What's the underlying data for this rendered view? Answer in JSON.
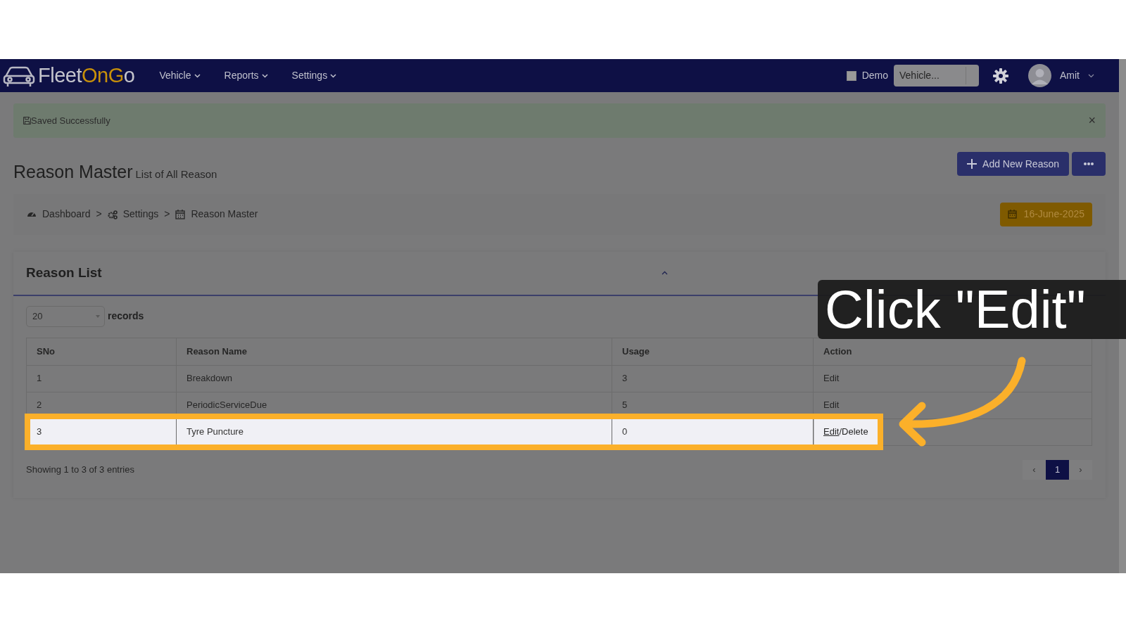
{
  "navbar": {
    "logo": [
      {
        "text": "Fleet",
        "color": "#c4c4cc"
      },
      {
        "text": "On",
        "color": "#c8900a"
      },
      {
        "text": "G",
        "color": "#c8900a"
      },
      {
        "text": "o",
        "color": "#c4c4cc"
      }
    ],
    "menus": [
      {
        "label": "Vehicle"
      },
      {
        "label": "Reports"
      },
      {
        "label": "Settings"
      }
    ],
    "demo": {
      "label": "Demo",
      "checked": false
    },
    "vehicle_select": {
      "value": "Vehicle..."
    },
    "user": {
      "name": "Amit"
    }
  },
  "alert": {
    "text": "Saved Successfully",
    "close": "×"
  },
  "page": {
    "title": "Reason Master",
    "subtitle": "List of All Reason",
    "buttons": [
      {
        "kind": "add",
        "label": "Add New Reason"
      },
      {
        "kind": "more"
      }
    ]
  },
  "breadcrumb": {
    "separator": ">",
    "items": [
      {
        "label": "Dashboard"
      },
      {
        "label": "Settings"
      },
      {
        "label": "Reason Master"
      }
    ]
  },
  "date": "16-June-2025",
  "card": {
    "title": "Reason List",
    "expanded": true,
    "page_size": "20",
    "page_size_label": "records",
    "columns": [
      "SNo",
      "Reason Name",
      "Usage",
      "Action"
    ],
    "rows": [
      {
        "cells": [
          "1",
          "Breakdown",
          "3"
        ],
        "highlighted": false,
        "actions": [
          {
            "label": "Edit",
            "hovered": false
          }
        ]
      },
      {
        "cells": [
          "2",
          "PeriodicServiceDue",
          "5"
        ],
        "highlighted": false,
        "actions": [
          {
            "label": "Edit",
            "hovered": false
          }
        ]
      },
      {
        "cells": [
          "3",
          "Tyre Puncture",
          "0"
        ],
        "highlighted": true,
        "actions": [
          {
            "label": "Edit",
            "hovered": true
          },
          {
            "label": "Delete",
            "hovered": false
          }
        ]
      }
    ],
    "action_separator": "/",
    "info": "Showing 1 to 3 of 3 entries",
    "pagination": {
      "prev": "‹",
      "next": "›",
      "pages": [
        {
          "label": "1",
          "selected": true
        }
      ]
    }
  },
  "callout": {
    "text": "Click \"Edit\""
  }
}
